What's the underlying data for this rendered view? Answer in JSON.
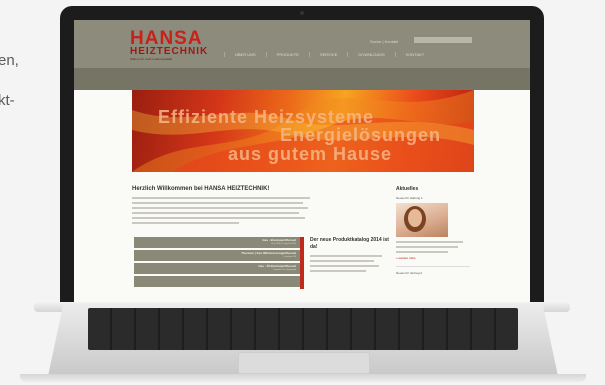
{
  "background_text": {
    "line1": "en,",
    "line2": "kt-"
  },
  "site": {
    "logo_main": "HANSA",
    "logo_sub": "HEIZTECHNIK",
    "logo_tagline": "Wärme für mehr Lebensqualität",
    "top_links": "Suche | Kontakt",
    "nav": [
      "ÜBER UNS",
      "PRODUKTE",
      "SERVICE",
      "DOWNLOADS",
      "KONTAKT"
    ]
  },
  "hero": {
    "line1": "Effiziente Heizsysteme",
    "line2": "Energielösungen",
    "line3": "aus gutem Hause"
  },
  "welcome": {
    "title": "Herzlich Willkommen bei HANSA HEIZTECHNIK!"
  },
  "catalog": {
    "rows": [
      {
        "title": "Gas - Brennwert/Kessel",
        "sub": "Plus 12/20 | Compakt 16/20"
      },
      {
        "title": "Thermen | Gas Wärmeerzeuger/Kessel",
        "sub": "Lieferform 3/4"
      },
      {
        "title": "Gas - Öl Brennwert/Kessel",
        "sub": "Compakt Plus | Integrated"
      },
      {
        "title": "",
        "sub": ""
      }
    ]
  },
  "news": {
    "title": "Der neue Produktkatalog 2014 ist da!"
  },
  "sidebar": {
    "title": "Aktuelles",
    "sub1": "Neues für Haltung 1",
    "link": "» weitere Infos",
    "sub2": "Neues für Vertrag 2"
  },
  "colors": {
    "brand_red": "#c8201a",
    "header": "#8d8c7c",
    "catalog_row": "#8a8978"
  }
}
